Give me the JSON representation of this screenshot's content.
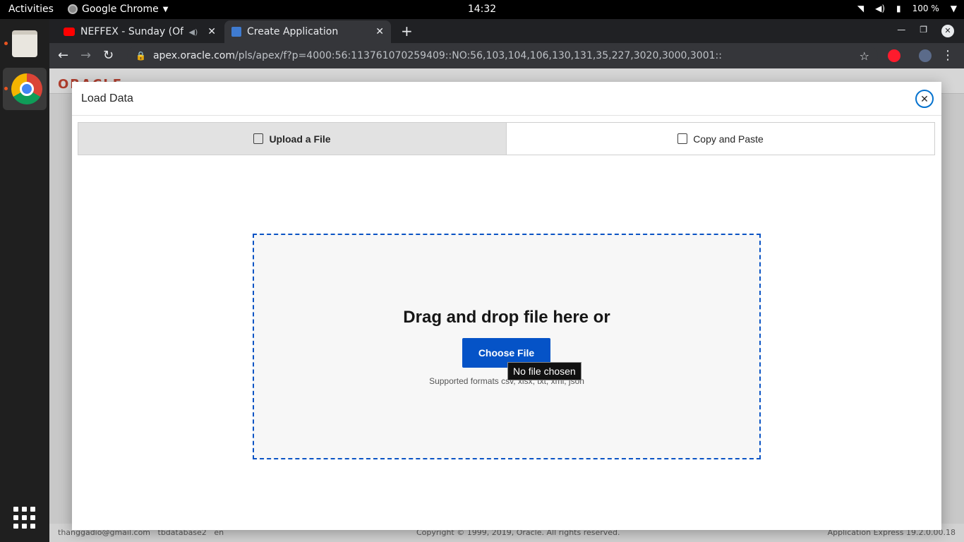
{
  "os": {
    "activities": "Activities",
    "app_name": "Google Chrome",
    "clock": "14:32",
    "battery": "100 %"
  },
  "browser": {
    "tabs": [
      {
        "title": "NEFFEX - Sunday (Offi",
        "favicon": "youtube-icon"
      },
      {
        "title": "Create Application",
        "favicon": "apex-icon"
      }
    ],
    "url_host": "apex.oracle.com",
    "url_path": "/pls/apex/f?p=4000:56:113761070259409::NO:56,103,104,106,130,131,35,227,3020,3000,3001::"
  },
  "page": {
    "footer_user": "thanggadio@gmail.com",
    "footer_workspace": "tbdatabase2",
    "footer_lang": "en",
    "footer_copyright": "Copyright © 1999, 2019, Oracle. All rights reserved.",
    "footer_version": "Application Express 19.2.0.00.18"
  },
  "dialog": {
    "title": "Load Data",
    "tabs": [
      {
        "label": "Upload a File",
        "selected": true
      },
      {
        "label": "Copy and Paste",
        "selected": false
      }
    ],
    "dropzone": {
      "heading": "Drag and drop file here or",
      "button": "Choose File",
      "formats": "Supported formats csv, xlsx, txt, xml, json",
      "tooltip": "No file chosen"
    }
  },
  "colors": {
    "accent": "#0553c7",
    "oracle_red": "#c74634"
  }
}
